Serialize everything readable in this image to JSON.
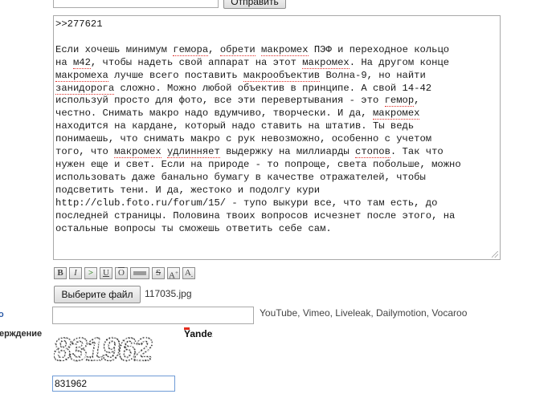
{
  "form": {
    "submit_label": "Отправить",
    "message_lines": [
      ">>277621",
      "",
      "Если хочешь минимум гемора, обрети макромех ПЭФ и переходное кольцо",
      "на м42, чтобы надеть свой аппарат на этот макромех. На другом конце",
      "макромеха лучше всего поставить макрообъектив Волна-9, но найти",
      "занидорога сложно. Можно любой объектив в принципе. А свой 14-42",
      "используй просто для фото, все эти перевертывания - это гемор,",
      "честно. Снимать макро надо вдумчиво, творчески. И да, макромех",
      "находится на кардане, который надо ставить на штатив. Ты ведь",
      "понимаешь, что снимать макро с рук невозможно, особенно с учетом",
      "того, что макромех удлинняет выдержку на миллиарды стопов. Так что",
      "нужен еще и свет. Если на природе - то попроще, света побольше, можно",
      "использовать даже банально бумагу в качестве отражателей, чтобы",
      "подсветить тени. И да, жестоко и подолгу кури",
      "http://club.foto.ru/forum/15/ - тупо выкури все, что там есть, до",
      "последней страницы. Половина твоих вопросов исчезнет после этого, на",
      "остальные вопросы ты сможешь ответить себе сам."
    ],
    "toolbar": {
      "bold": "B",
      "italic": "I",
      "quote": ">",
      "underline": "U",
      "overline": "O",
      "strike": "S",
      "sup": "A",
      "sub": "A"
    },
    "file_button_label": "Выберите файл",
    "file_name": "117035.jpg",
    "video_label": "о",
    "video_hint": "YouTube, Vimeo, Liveleak, Dailymotion, Vocaroo",
    "confirm_label": "ерждение",
    "captcha_text": "831962",
    "captcha_brand": "Yandex",
    "captcha_value": "831962"
  }
}
